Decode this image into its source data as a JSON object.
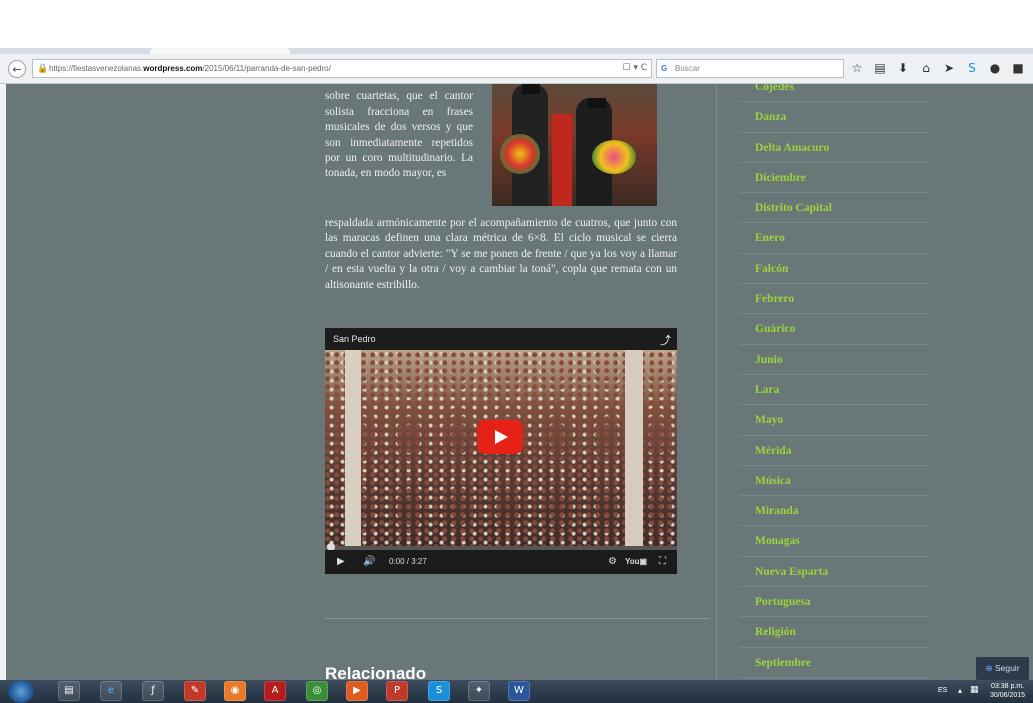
{
  "browser": {
    "url_prefix": "https://fiestasvenezolanas.",
    "url_host": "wordpress.com",
    "url_path": "/2015/06/11/parranda-de-san-pedro/",
    "search_placeholder": "Buscar"
  },
  "article": {
    "paragraph_narrow": "manifestación se estructura sobre cuartetas, que el cantor solista fracciona en frases musicales de dos versos y que son inmediatamente repetidos por un coro multitudinario. La tonada, en modo mayor, es",
    "paragraph_wide": "respaldada armónicamente por el acompañamiento de cuatros, que junto con las maracas definen una clara métrica de 6×8. El ciclo musical se cierra cuando el cantor advierte: \"Y se me ponen de frente / que ya los voy a llamar / en esta vuelta y la otra / voy a cambiar la toná\", copla que remata con un altisonante estribillo.",
    "video_title": "San Pedro",
    "video_time": "0:00 / 3:27",
    "related_heading": "Relacionado"
  },
  "sidebar": {
    "categories": [
      "Cojedes",
      "Danza",
      "Delta Amacuro",
      "Diciembre",
      "Distrito Capital",
      "Enero",
      "Falcón",
      "Febrero",
      "Guárico",
      "Junio",
      "Lara",
      "Mayo",
      "Mérida",
      "Música",
      "Miranda",
      "Monagas",
      "Nueva Esparta",
      "Portuguesa",
      "Religión",
      "Septiembre"
    ]
  },
  "follow_button": "Seguir",
  "taskbar": {
    "language": "ES",
    "time": "03:38 p.m.",
    "date": "30/06/2015"
  },
  "colors": {
    "page_background": "#6a7778",
    "category_link": "#9bd43a",
    "article_text": "#f0f0f0"
  }
}
